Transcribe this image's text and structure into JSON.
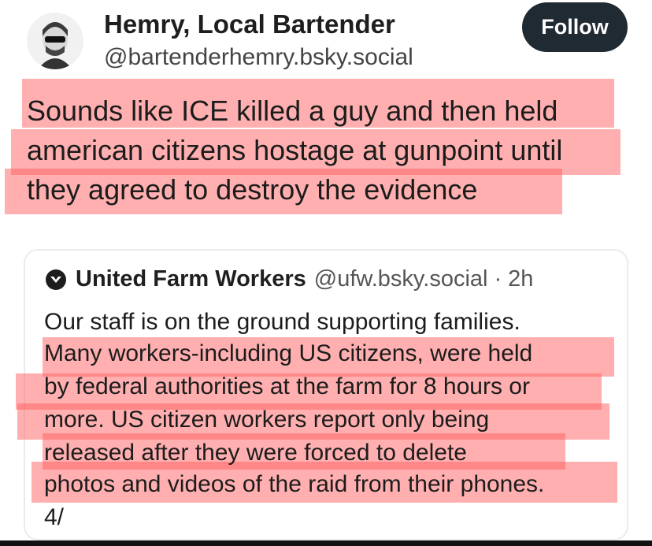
{
  "post": {
    "author_name": "Hemry, Local Bartender",
    "author_handle": "@bartenderhemry.bsky.social",
    "follow_label": "Follow",
    "text_lines": [
      "Sounds like ICE killed a guy and then held",
      "american citizens hostage at gunpoint until",
      "they agreed to destroy the evidence"
    ]
  },
  "quote": {
    "author_name": "United Farm Workers",
    "author_handle": "@ufw.bsky.social",
    "separator": "·",
    "time": "2h",
    "text_lines": [
      "Our staff is on the ground supporting families.",
      "Many workers-including US citizens, were held",
      "by federal authorities at the farm for 8 hours or",
      "more. US citizen workers report only being",
      "released after they were forced to delete",
      "photos and videos of the raid from their phones.",
      "4/"
    ]
  },
  "colors": {
    "highlight": "#ff5f5f",
    "follow_button_bg": "#1f2a33"
  }
}
